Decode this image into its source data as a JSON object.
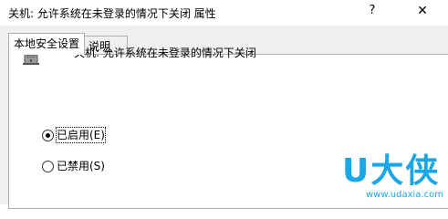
{
  "window": {
    "title": "关机: 允许系统在未登录的情况下关闭 属性",
    "help_label": "?",
    "close_label": "✕"
  },
  "tabs": [
    {
      "label": "本地安全设置",
      "active": true
    },
    {
      "label": "说明",
      "active": false
    }
  ],
  "policy": {
    "icon": "computer-tower-icon",
    "name": "关机: 允许系统在未登录的情况下关闭"
  },
  "options": [
    {
      "label": "已启用(E)",
      "selected": true
    },
    {
      "label": "已禁用(S)",
      "selected": false
    }
  ],
  "watermark": {
    "logo": "U大侠",
    "url": "www.udaxia.com",
    "color": "#1aa7e8"
  }
}
